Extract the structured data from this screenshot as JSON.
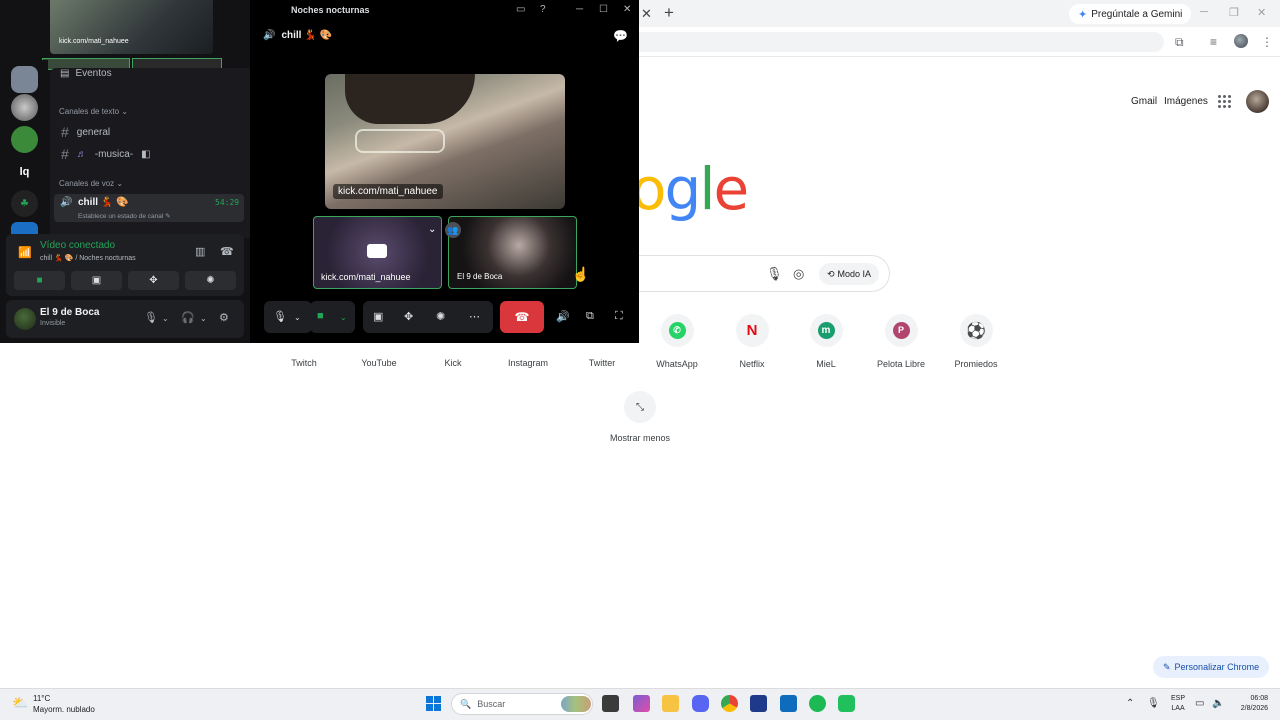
{
  "chrome": {
    "gemini_label": "Pregúntale a Gemini",
    "gmail": "Gmail",
    "images": "Imágenes",
    "logo_letters": [
      "o",
      "g",
      "l",
      "e"
    ],
    "modo_ia": "Modo IA",
    "shortcuts": [
      "Twitch",
      "YouTube",
      "Kick",
      "Instagram",
      "Twitter",
      "WhatsApp",
      "Netflix",
      "MieL",
      "Pelota Libre",
      "Promiedos"
    ],
    "shortcut_letters": {
      "netflix": "N",
      "miel": "m",
      "pelota": "P"
    },
    "show_less": "Mostrar menos",
    "personalize": "Personalizar Chrome"
  },
  "discord": {
    "window_title": "Noches nocturnas",
    "preview_label": "kick.com/mati_nahuee",
    "events": "Eventos",
    "text_category": "Canales de texto",
    "channel_general": "general",
    "channel_music": "-musica-",
    "voice_category": "Canales de voz",
    "voice_channel": "chill 💃 🎨",
    "voice_time": "54:29",
    "voice_status": "Establece un estado de canal",
    "connection_title": "Vídeo conectado",
    "connection_sub": "chill 💃 🎨 / Noches nocturnas",
    "user_name": "El 9 de Boca",
    "user_status": "Invisible",
    "header_channel": "chill 💃 🎨",
    "tile_main_label": "kick.com/mati_nahuee",
    "tile_a_label": "kick.com/mati_nahuee",
    "tile_b_label": "El 9 de Boca",
    "server_initials": "lq"
  },
  "taskbar": {
    "temp": "11°C",
    "weather": "Mayorm. nublado",
    "search": "Buscar",
    "lang1": "ESP",
    "lang2": "LAA",
    "time": "06:08",
    "date": "2/8/2026"
  }
}
